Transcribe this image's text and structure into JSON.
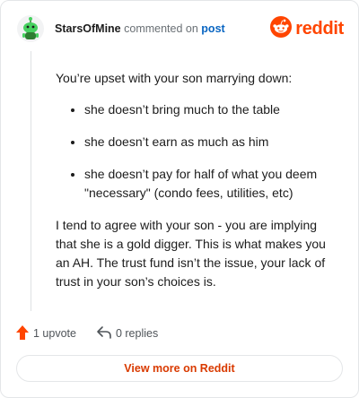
{
  "header": {
    "username": "StarsOfMine",
    "action_text": "commented on",
    "post_link": "post",
    "brand": "reddit"
  },
  "comment": {
    "intro": "You’re upset with your son marrying down:",
    "bullets": [
      "she doesn’t bring much to the table",
      "she doesn’t earn as much as him",
      "she doesn’t pay for half of what you deem \"necessary\" (condo fees, utilities, etc)"
    ],
    "conclusion": "I tend to agree with your son - you are implying that she is a gold digger. This is what makes you an AH. The trust fund isn’t the issue, your lack of trust in your son’s choices is."
  },
  "footer": {
    "upvotes_label": "1 upvote",
    "replies_label": "0 replies"
  },
  "view_more_label": "View more on Reddit",
  "colors": {
    "brand_orange": "#ff4500",
    "upvote_orange": "#ff4500",
    "link_blue": "#0a66c2",
    "cta_red": "#d93a00",
    "avatar_green": "#46d160"
  },
  "icons": {
    "avatar": "snoo-avatar-icon",
    "brand": "reddit-logo-icon",
    "upvote": "upvote-arrow-icon",
    "reply": "reply-arrow-icon"
  }
}
